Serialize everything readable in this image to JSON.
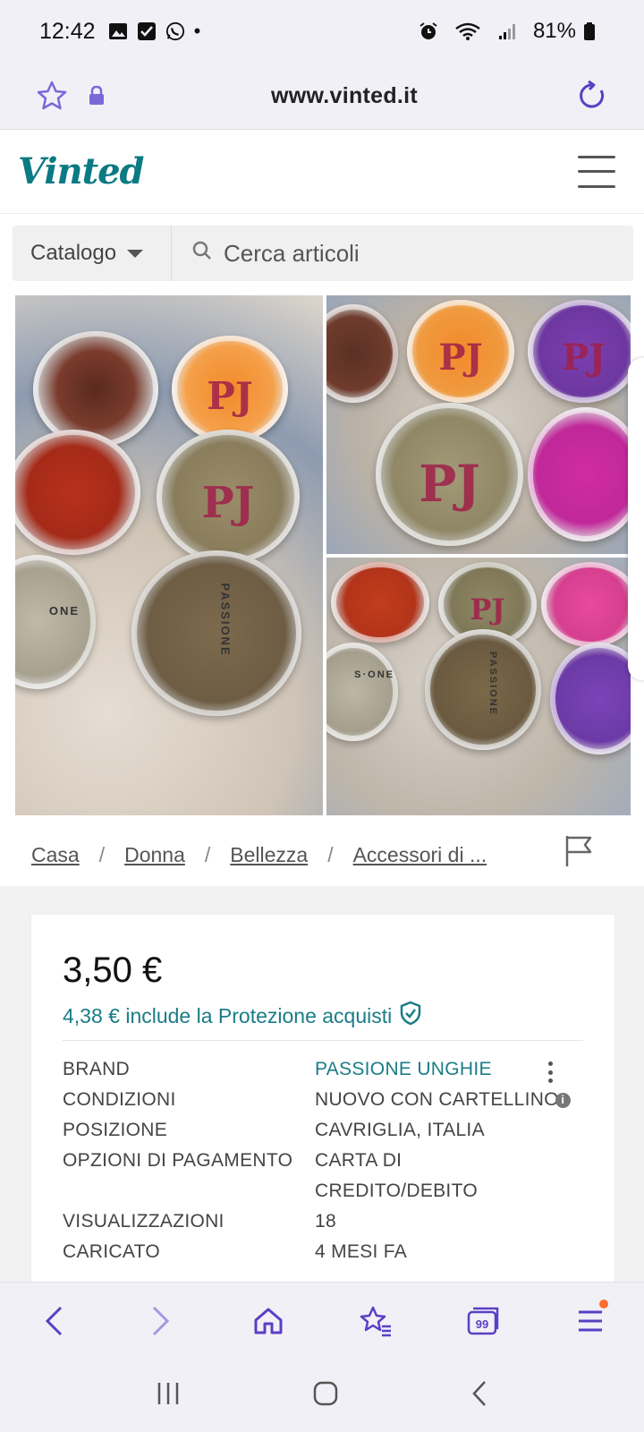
{
  "status_bar": {
    "time": "12:42",
    "battery": "81%",
    "dot": "•"
  },
  "browser": {
    "url": "www.vinted.it"
  },
  "site": {
    "logo": "Vinted"
  },
  "search": {
    "catalog_label": "Catalogo",
    "placeholder": "Cerca articoli"
  },
  "gallery": {
    "lid_text": "PJ",
    "jar_text": "PASSIONE",
    "jar_text_cut": "ONE",
    "jar_text_cut2": "S·ONE"
  },
  "breadcrumb": {
    "items": [
      "Casa",
      "Donna",
      "Bellezza",
      "Accessori di ..."
    ],
    "separator": "/"
  },
  "item": {
    "price": "3,50 €",
    "protection_text": "4,38 € include la Protezione acquisti",
    "details": [
      {
        "key": "BRAND",
        "value": "PASSIONE UNGHIE"
      },
      {
        "key": "CONDIZIONI",
        "value": "NUOVO CON CARTELLINO"
      },
      {
        "key": "POSIZIONE",
        "value": "CAVRIGLIA, ITALIA"
      },
      {
        "key": "OPZIONI DI PAGAMENTO",
        "value": "CARTA DI CREDITO/DEBITO"
      },
      {
        "key": "VISUALIZZAZIONI",
        "value": "18"
      },
      {
        "key": "CARICATO",
        "value": "4 MESI FA"
      }
    ]
  },
  "toolbar": {
    "tabs_count": "99"
  },
  "colors": {
    "brand": "#0b7a83",
    "browser_accent": "#5b3fc4",
    "link_teal": "#1a7d86"
  }
}
